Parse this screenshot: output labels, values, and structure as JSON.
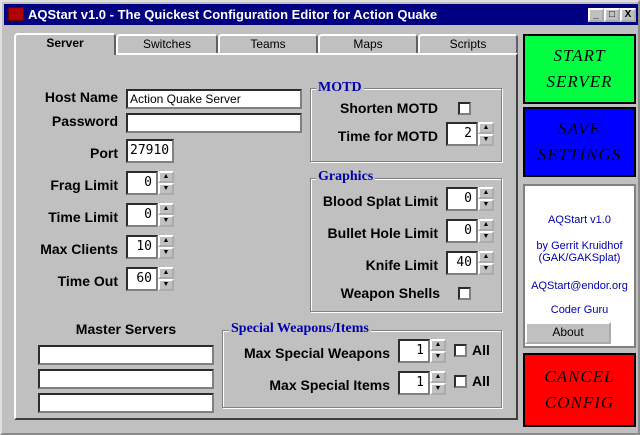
{
  "window": {
    "title": "AQStart v1.0 - The Quickest Configuration Editor for Action Quake",
    "minimize": "_",
    "maximize": "□",
    "close": "X"
  },
  "tabs": [
    {
      "label": "Server",
      "active": true
    },
    {
      "label": "Switches",
      "active": false
    },
    {
      "label": "Teams",
      "active": false
    },
    {
      "label": "Maps",
      "active": false
    },
    {
      "label": "Scripts",
      "active": false
    }
  ],
  "server": {
    "host_name_label": "Host Name",
    "host_name_value": "Action Quake Server",
    "password_label": "Password",
    "password_value": "",
    "port_label": "Port",
    "port_value": "27910",
    "frag_limit_label": "Frag Limit",
    "frag_limit_value": "0",
    "time_limit_label": "Time Limit",
    "time_limit_value": "0",
    "max_clients_label": "Max Clients",
    "max_clients_value": "10",
    "time_out_label": "Time Out",
    "time_out_value": "60"
  },
  "motd": {
    "title": "MOTD",
    "shorten_label": "Shorten MOTD",
    "shorten_checked": false,
    "time_label": "Time for MOTD",
    "time_value": "2"
  },
  "graphics": {
    "title": "Graphics",
    "blood_label": "Blood Splat Limit",
    "blood_value": "0",
    "bullet_label": "Bullet Hole Limit",
    "bullet_value": "0",
    "knife_label": "Knife Limit",
    "knife_value": "40",
    "shells_label": "Weapon Shells",
    "shells_checked": false
  },
  "master_servers": {
    "label": "Master Servers",
    "values": [
      "",
      "",
      ""
    ]
  },
  "special": {
    "title": "Special Weapons/Items",
    "weapons_label": "Max Special Weapons",
    "weapons_value": "1",
    "weapons_all_label": "All",
    "items_label": "Max Special Items",
    "items_value": "1",
    "items_all_label": "All"
  },
  "side": {
    "start_label": "START SERVER",
    "save_label": "SAVE SETTINGS",
    "cancel_label": "CANCEL CONFIG",
    "app_version": "AQStart v1.0",
    "author": "by Gerrit Kruidhof (GAK/GAKSplat)",
    "email": "AQStart@endor.org",
    "credit": "Coder Guru",
    "about_label": "About"
  },
  "colors": {
    "start_bg": "#00ff40",
    "save_bg": "#0000ff",
    "cancel_bg": "#ff0000",
    "title_bar": "#000080",
    "group_title": "#0000b0"
  }
}
